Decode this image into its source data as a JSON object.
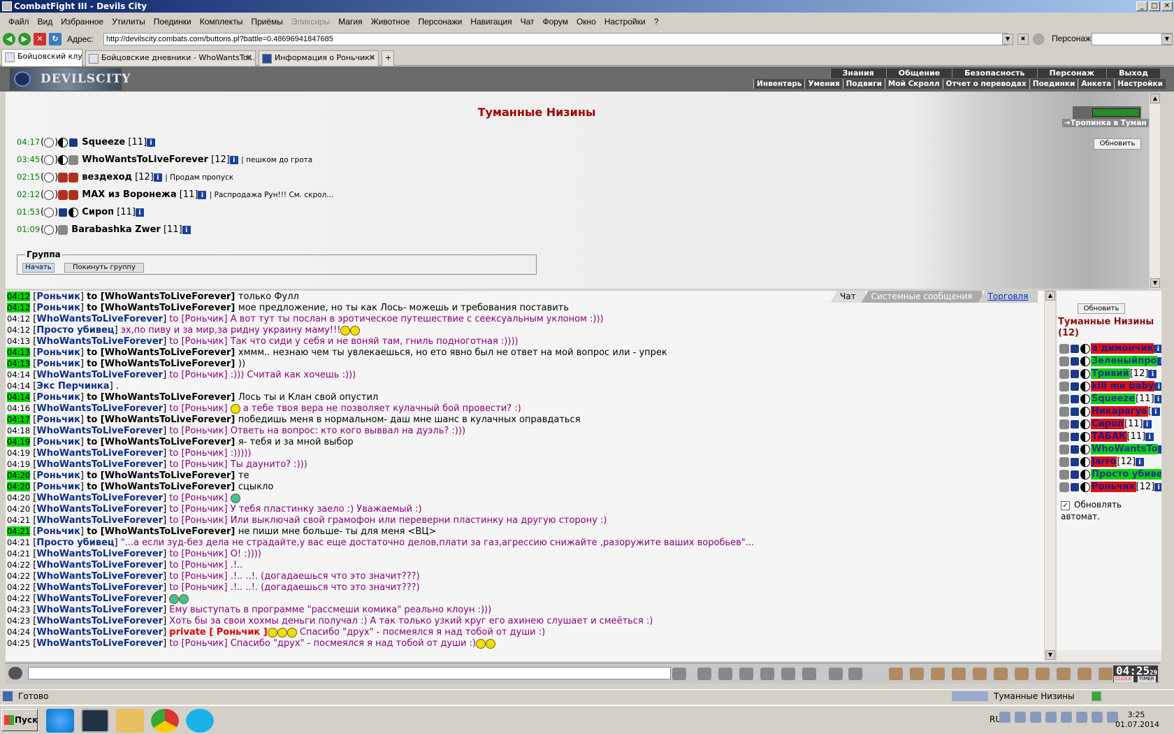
{
  "window": {
    "title": "CombatFight III - Devils City"
  },
  "menu": [
    "Файл",
    "Вид",
    "Избранное",
    "Утилиты",
    "Поединки",
    "Комплекты",
    "Приёмы",
    "Эликсиры",
    "Магия",
    "Животное",
    "Персонажи",
    "Навигация",
    "Чат",
    "Форум",
    "Окно",
    "Настройки",
    "?"
  ],
  "menu_disabled_index": 7,
  "address": {
    "label": "Адрес:",
    "url": "http://devilscity.combats.com/buttons.pl?battle=0.48696941847685",
    "persona_label": "Персонаж:"
  },
  "tabs": [
    "Бойцовский клуб",
    "Бойцовские дневники - WhoWantsTo...",
    "Информация о Роньчик"
  ],
  "brand": "DEVILSCITY",
  "topnav": [
    "Знания",
    "Общение",
    "Безопасность",
    "Персонаж",
    "Выход"
  ],
  "subnav": [
    "Инвентарь",
    "Умения",
    "Подвиги",
    "Мой Скролл",
    "Отчет о переводах",
    "Поединки",
    "Анкета",
    "Настройки"
  ],
  "location": {
    "title": "Туманные Низины",
    "players": [
      {
        "time": "04:17",
        "name": "Squeeze",
        "level": "[11]",
        "note": ""
      },
      {
        "time": "03:45",
        "name": "WhoWantsToLiveForever",
        "level": "[12]",
        "note": "| пешком до грота"
      },
      {
        "time": "02:15",
        "name": "вездеход",
        "level": "[12]",
        "note": "| Продам пропуск"
      },
      {
        "time": "02:12",
        "name": "MAX из Воронежа",
        "level": "[11]",
        "note": "| Распродажа Рун!!! См. скрол..."
      },
      {
        "time": "01:53",
        "name": "Сироп",
        "level": "[11]",
        "note": ""
      },
      {
        "time": "01:09",
        "name": "Barabashka Zwer",
        "level": "[11]",
        "note": ""
      }
    ],
    "group_label": "Группа",
    "start_btn": "Начать",
    "leave_btn": "Покинуть группу",
    "route_label": "Тропинка в Туман",
    "refresh_btn": "Обновить"
  },
  "chat_tabs": [
    "Чат",
    "Системные сообщения",
    "Торговля"
  ],
  "chat": [
    {
      "t": "04:12",
      "hl": true,
      "from": "Роньчик",
      "to": "WhoWantsToLiveForever",
      "mode": "norm",
      "text": "только Фулл"
    },
    {
      "t": "04:12",
      "hl": true,
      "from": "Роньчик",
      "to": "WhoWantsToLiveForever",
      "mode": "norm",
      "text": "мое предложение, но ты как Лось- можешь и требования поставить"
    },
    {
      "t": "04:12",
      "hl": false,
      "from": "WhoWantsToLiveForever",
      "to": "Роньчик",
      "mode": "priv",
      "text": "А вот тут ты послан в эротическое путешествие с сеексуальным уклоном :)))"
    },
    {
      "t": "04:12",
      "hl": false,
      "from": "Просто убивец",
      "to": "",
      "mode": "priv",
      "text": "эх,по пиву и за мир,за ридну украину маму!!!",
      "emo": 2
    },
    {
      "t": "04:13",
      "hl": false,
      "from": "WhoWantsToLiveForever",
      "to": "Роньчик",
      "mode": "priv",
      "text": "Так что сиди у себя и не воняй там, гниль подноготная :))))"
    },
    {
      "t": "04:13",
      "hl": true,
      "from": "Роньчик",
      "to": "WhoWantsToLiveForever",
      "mode": "norm",
      "text": "хммм.. незнаю чем ты увлекаешься, но ето явно был не ответ на мой вопрос или - упрек"
    },
    {
      "t": "04:13",
      "hl": true,
      "from": "Роньчик",
      "to": "WhoWantsToLiveForever",
      "mode": "norm",
      "text": "))"
    },
    {
      "t": "04:14",
      "hl": false,
      "from": "WhoWantsToLiveForever",
      "to": "Роньчик",
      "mode": "priv",
      "text": ":))) Считай как хочешь :)))"
    },
    {
      "t": "04:14",
      "hl": false,
      "from": "Экс Перчинка",
      "to": "",
      "mode": "norm",
      "text": "."
    },
    {
      "t": "04:14",
      "hl": true,
      "from": "Роньчик",
      "to": "WhoWantsToLiveForever",
      "mode": "norm",
      "text": "Лось ты и Клан свой опустил"
    },
    {
      "t": "04:16",
      "hl": false,
      "from": "WhoWantsToLiveForever",
      "to": "Роньчик",
      "mode": "priv",
      "text": "а тебе твоя вера не позволяет кулачный бой провести? :)",
      "emo_before": 1
    },
    {
      "t": "04:17",
      "hl": true,
      "from": "Роньчик",
      "to": "WhoWantsToLiveForever",
      "mode": "norm",
      "text": "победишь меня в нормальном- даш мне шанс в кулачных оправдаться"
    },
    {
      "t": "04:18",
      "hl": false,
      "from": "WhoWantsToLiveForever",
      "to": "Роньчик",
      "mode": "priv",
      "text": "Ответь на вопрос: кто кого выввал на дуэль? :)))"
    },
    {
      "t": "04:19",
      "hl": true,
      "from": "Роньчик",
      "to": "WhoWantsToLiveForever",
      "mode": "norm",
      "text": "я- тебя и за мной выбор"
    },
    {
      "t": "04:19",
      "hl": false,
      "from": "WhoWantsToLiveForever",
      "to": "Роньчик",
      "mode": "priv",
      "text": ":)))))"
    },
    {
      "t": "04:19",
      "hl": false,
      "from": "WhoWantsToLiveForever",
      "to": "Роньчик",
      "mode": "priv",
      "text": "Ты даунито? :)))"
    },
    {
      "t": "04:20",
      "hl": true,
      "from": "Роньчик",
      "to": "WhoWantsToLiveForever",
      "mode": "norm",
      "text": "те"
    },
    {
      "t": "04:20",
      "hl": true,
      "from": "Роньчик",
      "to": "WhoWantsToLiveForever",
      "mode": "norm",
      "text": "сцыкло"
    },
    {
      "t": "04:20",
      "hl": false,
      "from": "WhoWantsToLiveForever",
      "to": "Роньчик",
      "mode": "priv",
      "text": "",
      "emo_blue": 1
    },
    {
      "t": "04:20",
      "hl": false,
      "from": "WhoWantsToLiveForever",
      "to": "Роньчик",
      "mode": "priv",
      "text": "У тебя пластинку заело :) Уважаемый :)"
    },
    {
      "t": "04:21",
      "hl": false,
      "from": "WhoWantsToLiveForever",
      "to": "Роньчик",
      "mode": "priv",
      "text": "Или выключай свой грамофон или переверни пластинку на другую сторону :)"
    },
    {
      "t": "04:21",
      "hl": true,
      "from": "Роньчик",
      "to": "WhoWantsToLiveForever",
      "mode": "norm",
      "text": "не пиши мне больше- ты для меня <ВЦ>"
    },
    {
      "t": "04:21",
      "hl": false,
      "from": "Просто убивец",
      "to": "",
      "mode": "priv",
      "text": "\"...а если зуд-без дела не страдайте,у вас еще достаточно делов,плати за газ,агрессию снижайте ,разоружите ваших воробьев\"..."
    },
    {
      "t": "04:21",
      "hl": false,
      "from": "WhoWantsToLiveForever",
      "to": "Роньчик",
      "mode": "priv",
      "text": "О! :))))"
    },
    {
      "t": "04:22",
      "hl": false,
      "from": "WhoWantsToLiveForever",
      "to": "Роньчик",
      "mode": "priv",
      "text": ".!.."
    },
    {
      "t": "04:22",
      "hl": false,
      "from": "WhoWantsToLiveForever",
      "to": "Роньчик",
      "mode": "priv",
      "text": ".!.. ..!. (догадаешься что это значит???)"
    },
    {
      "t": "04:22",
      "hl": false,
      "from": "WhoWantsToLiveForever",
      "to": "Роньчик",
      "mode": "priv",
      "text": ".!.. ..!. (догадаешься что это значит???)"
    },
    {
      "t": "04:22",
      "hl": false,
      "from": "WhoWantsToLiveForever",
      "to": "",
      "mode": "priv",
      "text": "",
      "emo_blue": 2
    },
    {
      "t": "04:23",
      "hl": false,
      "from": "WhoWantsToLiveForever",
      "to": "",
      "mode": "priv",
      "text": "Ему выступать в программе \"рассмеши комика\" реально клоун :)))"
    },
    {
      "t": "04:23",
      "hl": false,
      "from": "WhoWantsToLiveForever",
      "to": "",
      "mode": "priv",
      "text": "Хоть бы за свои хохмы деньги получал :) А так только узкий круг его ахинею слушает и смеёться :)"
    },
    {
      "t": "04:24",
      "hl": false,
      "from": "WhoWantsToLiveForever",
      "to": "",
      "mode": "priv",
      "private": "private [ Роньчик ]",
      "text": "Спасибо \"друх\" - посмеялся я над тобой от души :)",
      "emo_before": 3
    },
    {
      "t": "04:25",
      "hl": false,
      "from": "WhoWantsToLiveForever",
      "to": "Роньчик",
      "mode": "priv",
      "text": "Спасибо \"друх\" - посмеялся я над тобой от души :)",
      "emo": 2
    }
  ],
  "userpanel": {
    "refresh_btn": "Обновить",
    "location": "Туманные Низины (12)",
    "users": [
      {
        "name": "a димончик",
        "lvl": "",
        "c": "red"
      },
      {
        "name": "Зеленыйпро",
        "lvl": "",
        "c": "green"
      },
      {
        "name": "Тривий",
        "lvl": "[12]",
        "c": "green"
      },
      {
        "name": "kill me baby",
        "lvl": "",
        "c": "red"
      },
      {
        "name": "Squeeze",
        "lvl": "[11]",
        "c": "green"
      },
      {
        "name": "Никарагуа",
        "lvl": "[",
        "c": "red"
      },
      {
        "name": "Сироп",
        "lvl": "[11]",
        "c": "red"
      },
      {
        "name": "ТАБАК",
        "lvl": "[11]",
        "c": "red"
      },
      {
        "name": "WhoWantsTo",
        "lvl": "",
        "c": "green"
      },
      {
        "name": "Jarro",
        "lvl": "[12]",
        "c": "red"
      },
      {
        "name": "Просто убивец",
        "lvl": "",
        "c": "green"
      },
      {
        "name": "Роньчик",
        "lvl": "[12]",
        "c": "red"
      }
    ],
    "auto_label": "Обновлять автомат.",
    "auto_checked": "✓"
  },
  "clock": {
    "time": "04:25",
    "sec": "29",
    "clock_label": "CLOCK",
    "timer_label": "TIMER"
  },
  "status": {
    "text": "Готово",
    "location": "Туманные Низины"
  },
  "taskbar": {
    "start": "Пуск",
    "lang": "RU",
    "time": "3:25",
    "date": "01.07.2014"
  },
  "icons": {
    "info": "i",
    "close": "✖"
  }
}
